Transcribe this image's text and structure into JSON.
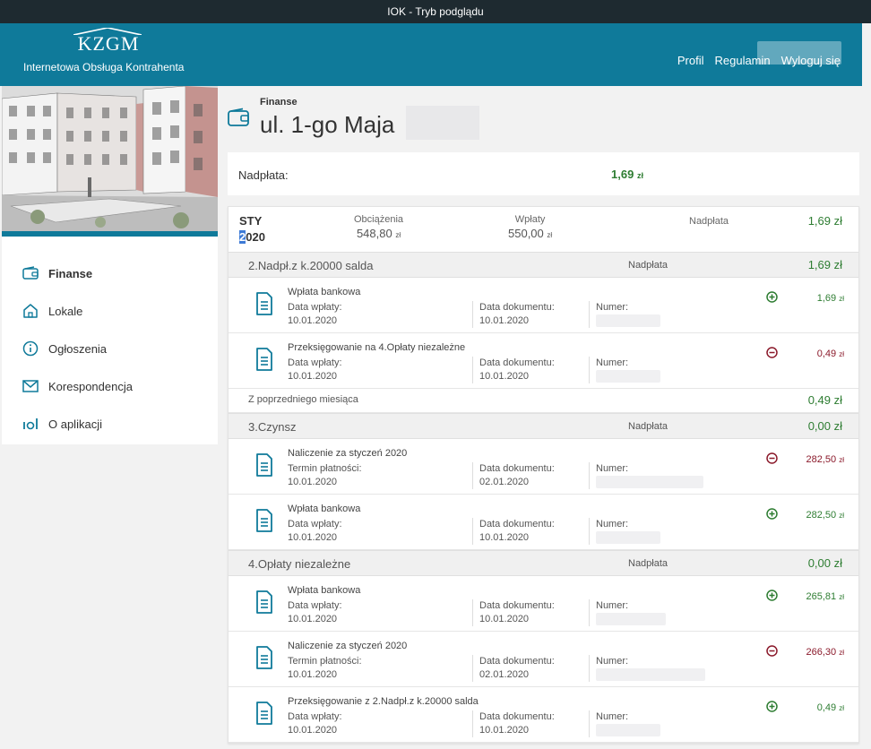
{
  "topbar": {
    "title": "IOK - Tryb podglądu"
  },
  "header": {
    "logo": "KZGM",
    "subtitle": "Internetowa Obsługa Kontrahenta",
    "nav": [
      "Profil",
      "Regulamin",
      "Wyloguj się"
    ]
  },
  "sidebar": {
    "items": [
      {
        "label": "Finanse",
        "icon": "wallet-icon"
      },
      {
        "label": "Lokale",
        "icon": "home-icon"
      },
      {
        "label": "Ogłoszenia",
        "icon": "info-icon"
      },
      {
        "label": "Korespondencja",
        "icon": "mail-icon"
      },
      {
        "label": "O aplikacji",
        "icon": "about-icon"
      }
    ]
  },
  "page": {
    "breadcrumb": "Finanse",
    "title": "ul. 1-go Maja"
  },
  "overpayment": {
    "label": "Nadpłata:",
    "value": "1,69",
    "currency": "zł"
  },
  "month": {
    "name": "STY",
    "year_first": "2",
    "year_rest": "020",
    "charges_label": "Obciążenia",
    "charges_value": "548,80",
    "payments_label": "Wpłaty",
    "payments_value": "550,00",
    "overpay_label": "Nadpłata",
    "overpay_value": "1,69 zł",
    "currency": "zł"
  },
  "groups": [
    {
      "name": "2.Nadpł.z k.20000 salda",
      "label": "Nadpłata",
      "value": "1,69 zł",
      "transactions": [
        {
          "title": "Wpłata bankowa",
          "date_label": "Data wpłaty:",
          "date": "10.01.2020",
          "doc_label": "Data dokumentu:",
          "doc_date": "10.01.2020",
          "num_label": "Numer:",
          "amount": "1,69",
          "currency": "zł"
        },
        {
          "title": "Przeksięgowanie na 4.Opłaty niezależne",
          "date_label": "Data wpłaty:",
          "date": "10.01.2020",
          "doc_label": "Data dokumentu:",
          "doc_date": "10.01.2020",
          "num_label": "Numer:",
          "amount": "0,49",
          "currency": "zł"
        }
      ],
      "carry_label": "Z poprzedniego miesiąca",
      "carry_value": "0,49 zł"
    },
    {
      "name": "3.Czynsz",
      "label": "Nadpłata",
      "value": "0,00 zł",
      "transactions": [
        {
          "title": "Naliczenie za styczeń 2020",
          "date_label": "Termin płatności:",
          "date": "10.01.2020",
          "doc_label": "Data dokumentu:",
          "doc_date": "02.01.2020",
          "num_label": "Numer:",
          "amount": "282,50",
          "currency": "zł"
        },
        {
          "title": "Wpłata bankowa",
          "date_label": "Data wpłaty:",
          "date": "10.01.2020",
          "doc_label": "Data dokumentu:",
          "doc_date": "10.01.2020",
          "num_label": "Numer:",
          "amount": "282,50",
          "currency": "zł"
        }
      ]
    },
    {
      "name": "4.Opłaty niezależne",
      "label": "Nadpłata",
      "value": "0,00 zł",
      "transactions": [
        {
          "title": "Wpłata bankowa",
          "date_label": "Data wpłaty:",
          "date": "10.01.2020",
          "doc_label": "Data dokumentu:",
          "doc_date": "10.01.2020",
          "num_label": "Numer:",
          "amount": "265,81",
          "currency": "zł"
        },
        {
          "title": "Naliczenie za styczeń 2020",
          "date_label": "Termin płatności:",
          "date": "10.01.2020",
          "doc_label": "Data dokumentu:",
          "doc_date": "02.01.2020",
          "num_label": "Numer:",
          "amount": "266,30",
          "currency": "zł"
        },
        {
          "title": "Przeksięgowanie z 2.Nadpł.z k.20000 salda",
          "date_label": "Data wpłaty:",
          "date": "10.01.2020",
          "doc_label": "Data dokumentu:",
          "doc_date": "10.01.2020",
          "num_label": "Numer:",
          "amount": "0,49",
          "currency": "zł"
        }
      ]
    }
  ],
  "colors": {
    "brand": "#0f7a9a",
    "positive": "#2e7d32",
    "negative": "#8b1a2b",
    "topbar": "#1e2a30"
  },
  "icons": {
    "plus": "plus-circle-icon",
    "minus": "minus-circle-icon",
    "document": "document-icon"
  }
}
